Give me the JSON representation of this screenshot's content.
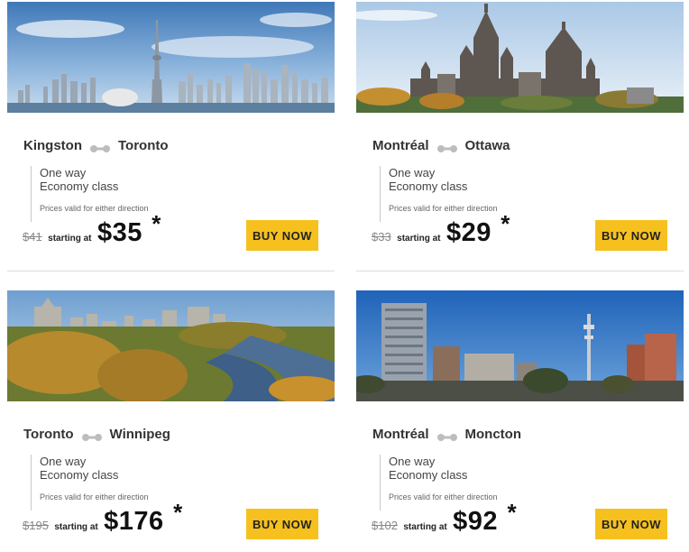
{
  "deals": [
    {
      "from": "Kingston",
      "to": "Toronto",
      "trip": "One way",
      "cabin": "Economy class",
      "validity": "Prices valid for either direction",
      "old_price": "$41",
      "starting_label": "starting at",
      "price": "$35",
      "asterisk": "*",
      "buy_label": "BUY NOW"
    },
    {
      "from": "Montréal",
      "to": "Ottawa",
      "trip": "One way",
      "cabin": "Economy class",
      "validity": "Prices valid for either direction",
      "old_price": "$33",
      "starting_label": "starting at",
      "price": "$29",
      "asterisk": "*",
      "buy_label": "BUY NOW"
    },
    {
      "from": "Toronto",
      "to": "Winnipeg",
      "trip": "One way",
      "cabin": "Economy class",
      "validity": "Prices valid for either direction",
      "old_price": "$195",
      "starting_label": "starting at",
      "price": "$176",
      "asterisk": "*",
      "buy_label": "BUY NOW"
    },
    {
      "from": "Montréal",
      "to": "Moncton",
      "trip": "One way",
      "cabin": "Economy class",
      "validity": "Prices valid for either direction",
      "old_price": "$102",
      "starting_label": "starting at",
      "price": "$92",
      "asterisk": "*",
      "buy_label": "BUY NOW"
    }
  ],
  "colors": {
    "button": "#f6c11e",
    "divider": "#dcdcdc",
    "route_link_icon": "#bdbdbd"
  },
  "icons": {
    "route_link": "route-link-icon"
  }
}
